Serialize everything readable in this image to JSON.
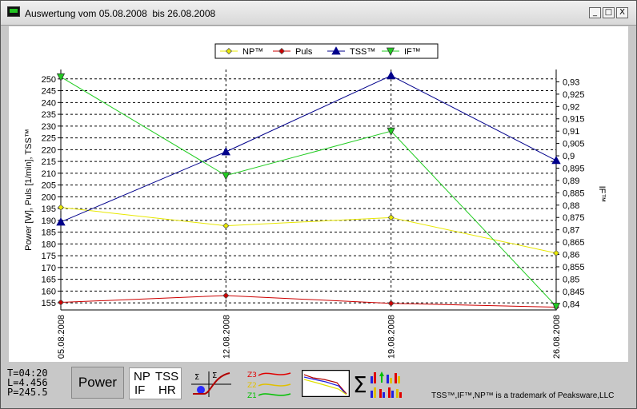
{
  "window": {
    "title": "Auswertung vom 05.08.2008  bis 26.08.2008",
    "buttons": {
      "minimize": "_",
      "maximize": "□",
      "close": "X"
    }
  },
  "chart_data": {
    "type": "line",
    "x": [
      "05.08.2008",
      "12.08.2008",
      "19.08.2008",
      "26.08.2008"
    ],
    "ylabel_left": "Power [W],   Puls [1/min],   TSS™",
    "ylabel_right": "IF™",
    "ylim_left": [
      152,
      254
    ],
    "ylim_right": [
      0.8375,
      0.935
    ],
    "yticks_left": [
      155,
      160,
      165,
      170,
      175,
      180,
      185,
      190,
      195,
      200,
      205,
      210,
      215,
      220,
      225,
      230,
      235,
      240,
      245,
      250
    ],
    "yticks_right": [
      "0,84",
      "0,845",
      "0,85",
      "0,855",
      "0,86",
      "0,865",
      "0,87",
      "0,875",
      "0,88",
      "0,885",
      "0,89",
      "0,895",
      "0,9",
      "0,905",
      "0,91",
      "0,915",
      "0,92",
      "0,925",
      "0,93"
    ],
    "yticks_right_values": [
      0.84,
      0.845,
      0.85,
      0.855,
      0.86,
      0.865,
      0.87,
      0.875,
      0.88,
      0.885,
      0.89,
      0.895,
      0.9,
      0.905,
      0.91,
      0.915,
      0.92,
      0.925,
      0.93
    ],
    "grid": true,
    "legend_position": "top-center",
    "series": [
      {
        "name": "NP™",
        "axis": "left",
        "color": "#e8e800",
        "marker": "diamond",
        "values": [
          195.5,
          187.7,
          191.2,
          176.1
        ]
      },
      {
        "name": "Puls",
        "axis": "left",
        "color": "#cc0000",
        "marker": "diamond",
        "values": [
          155.2,
          158.1,
          154.8,
          153.2
        ]
      },
      {
        "name": "TSS™",
        "axis": "left",
        "color": "#00008b",
        "marker": "triangle-up",
        "values": [
          189.3,
          219.1,
          251.4,
          215.4
        ]
      },
      {
        "name": "IF™",
        "axis": "right",
        "color": "#22cc22",
        "marker": "triangle-down",
        "values": [
          0.932,
          0.892,
          0.91,
          0.839
        ]
      }
    ]
  },
  "stats": {
    "time": "T=04:20",
    "load": "L=4.456",
    "power": "P=245.5"
  },
  "toolbar": {
    "power_label": "Power",
    "np": "NP",
    "tss": "TSS",
    "if_label": "IF",
    "hr": "HR",
    "zone_labels": [
      "Z3",
      "Z2",
      "Z1"
    ],
    "sigma": "Σ"
  },
  "footer": {
    "trademark": "TSS™,IF™,NP™ is a trademark of Peaksware,LLC"
  },
  "colors": {
    "np": "#e8e800",
    "puls": "#cc0000",
    "tss": "#00008b",
    "if": "#22cc22"
  }
}
